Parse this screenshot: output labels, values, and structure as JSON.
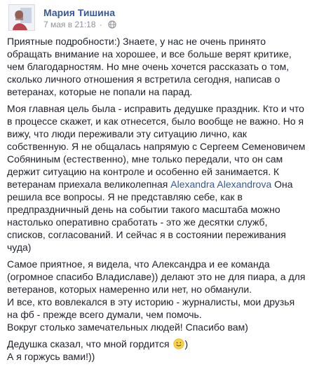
{
  "post": {
    "author": "Мария Тишина",
    "date": "7 мая в 21:18",
    "separator": "·",
    "paragraphs": {
      "p1": "Приятные подробности:) Знаете, у нас не очень принято обращать внимание на хорошее, и все больше верят критике, чем благодарностям. Но мне очень хочется рассказать о том, сколько личного отношения я встретила сегодня, написав о ветеранах, которые не попали на парад.",
      "p2_before": "Моя главная цель была - исправить дедушке праздник. Кто и что в процессе скажет, и как отнесется, было вообще не важно. Но я вижу, что люди переживали эту ситуацию лично, как собственную. Я не общалась напрямую с Сергеем Семеновичем Собяниным (естественно), мне только передали, что он сам держит ситуацию на контроле и особенно ей занимается. К ветеранам приехала великолепная",
      "p2_mention": "Alexandra Alexandrova",
      "p2_after": "Она решила все вопросы. Я не представляю себе, как в предпраздничный день на событии такого масштаба можно настолько оперативно сработать - это же десятки служб, списков, согласований. И сейчас я в состоянии переживания чуда)",
      "p3_line1": "Самое приятное, я видела, что Александра и ее команда (огромное спасибо Владиславе)) делают это не для пиара, а для ветеранов, которых намеренно или нет, но обманули.",
      "p3_line2": "И все, кто вовлекался в эту историю - журналисты, мои друзья на фб - прежде всего думали, чем помочь.",
      "p3_line3": "Вокруг столько замечательных людей! Спасибо вам)",
      "p4_line1_before": "Дедушка сказал, что мной гордится",
      "p4_line1_after": ")",
      "p4_line2": "А я горжусь вами!))"
    }
  },
  "icons": {
    "avatar": "profile-photo",
    "globe": "globe-icon",
    "emoji": "smiling-face-emoji"
  },
  "colors": {
    "link": "#385898",
    "text": "#1d2129",
    "meta": "#90949c"
  }
}
